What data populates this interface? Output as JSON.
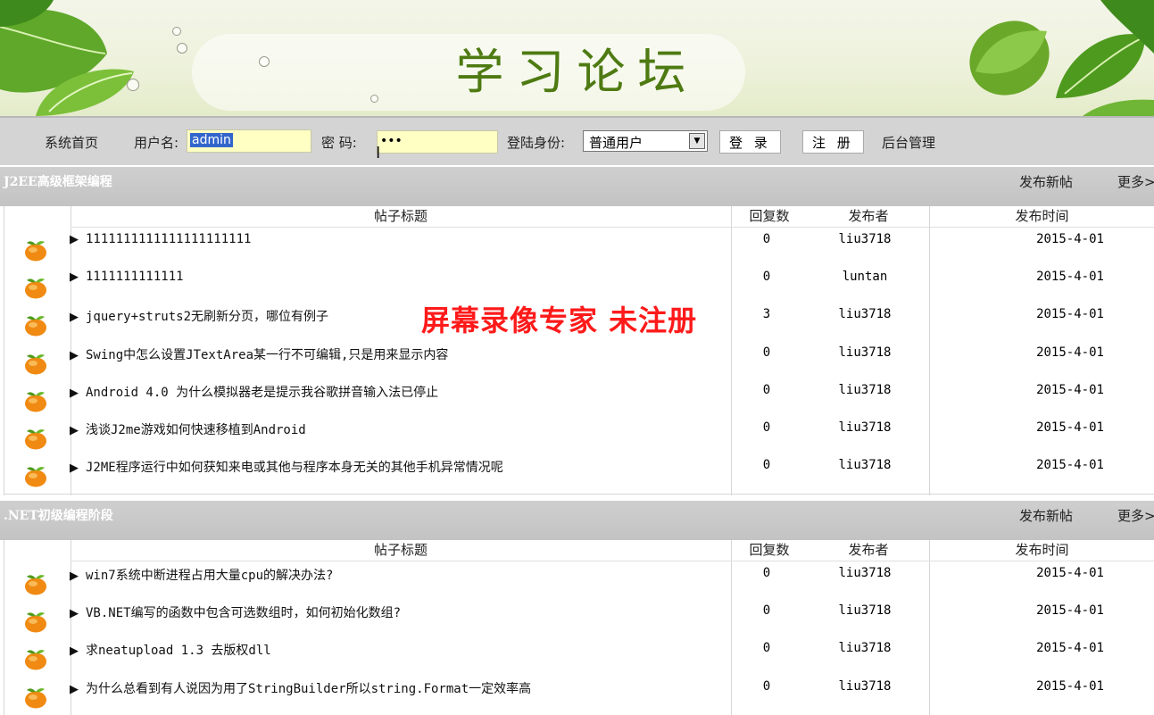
{
  "banner": {
    "title": "学习论坛"
  },
  "login": {
    "home": "系统首页",
    "username_label": "用户名:",
    "username_value": "admin",
    "password_label": "密  码:",
    "password_value": "•••",
    "role_label": "登陆身份:",
    "role_value": "普通用户",
    "login_button": "登 录",
    "register_button": "注 册",
    "admin": "后台管理"
  },
  "columns": {
    "title": "帖子标题",
    "replies": "回复数",
    "author": "发布者",
    "time": "发布时间"
  },
  "sections": [
    {
      "title": "J2EE高级框架编程",
      "new_post": "发布新帖",
      "more": "更多>",
      "rows": [
        {
          "title": "1111111111111111111111",
          "replies": "0",
          "author": "liu3718",
          "time": "2015-4-01"
        },
        {
          "title": "1111111111111",
          "replies": "0",
          "author": "luntan",
          "time": "2015-4-01"
        },
        {
          "title": "jquery+struts2无刷新分页，哪位有例子",
          "replies": "3",
          "author": "liu3718",
          "time": "2015-4-01"
        },
        {
          "title": "Swing中怎么设置JTextArea某一行不可编辑,只是用来显示内容",
          "replies": "0",
          "author": "liu3718",
          "time": "2015-4-01"
        },
        {
          "title": "Android 4.0 为什么模拟器老是提示我谷歌拼音输入法已停止",
          "replies": "0",
          "author": "liu3718",
          "time": "2015-4-01"
        },
        {
          "title": "浅谈J2me游戏如何快速移植到Android",
          "replies": "0",
          "author": "liu3718",
          "time": "2015-4-01"
        },
        {
          "title": "J2ME程序运行中如何获知来电或其他与程序本身无关的其他手机异常情况呢",
          "replies": "0",
          "author": "liu3718",
          "time": "2015-4-01"
        }
      ]
    },
    {
      "title": ".NET初级编程阶段",
      "new_post": "发布新帖",
      "more": "更多>",
      "rows": [
        {
          "title": "win7系统中断进程占用大量cpu的解决办法?",
          "replies": "0",
          "author": "liu3718",
          "time": "2015-4-01"
        },
        {
          "title": "VB.NET编写的函数中包含可选数组时，如何初始化数组?",
          "replies": "0",
          "author": "liu3718",
          "time": "2015-4-01"
        },
        {
          "title": "求neatupload 1.3 去版权dll",
          "replies": "0",
          "author": "liu3718",
          "time": "2015-4-01"
        },
        {
          "title": "为什么总看到有人说因为用了StringBuilder所以string.Format一定效率高",
          "replies": "0",
          "author": "liu3718",
          "time": "2015-4-01"
        }
      ]
    }
  ],
  "watermark": "屏幕录像专家  未注册"
}
